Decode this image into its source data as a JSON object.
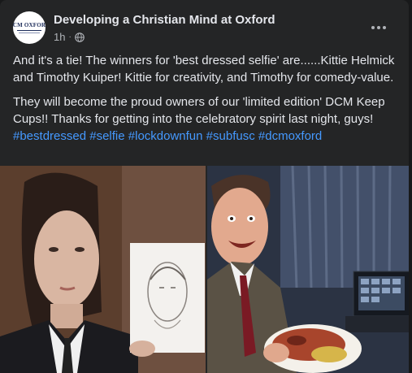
{
  "post": {
    "page_name": "Developing a Christian Mind at Oxford",
    "avatar_text": "DCM OXFORD",
    "time": "1h",
    "paragraph1": "And it's a tie! The winners for 'best dressed selfie' are......Kittie Helmick and Timothy Kuiper! Kittie for creativity, and Timothy for comedy-value.",
    "paragraph2": "They will become the proud owners of our 'limited edition' DCM Keep Cups!! Thanks for getting into the celebratory spirit last night, guys!",
    "hashtags": [
      "#bestdressed",
      "#selfie",
      "#lockdownfun",
      "#subfusc",
      "#dcmoxford"
    ]
  },
  "icons": {
    "globe": "globe-icon",
    "more": "more-options-icon"
  },
  "colors": {
    "background": "#18191a",
    "card": "#242526",
    "text_primary": "#e4e6eb",
    "text_secondary": "#b0b3b8",
    "link": "#4599ff"
  }
}
